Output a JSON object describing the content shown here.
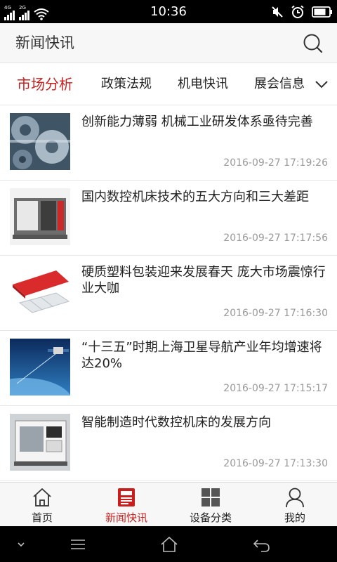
{
  "status_bar": {
    "time": "10:36",
    "sim1_label": "4G",
    "sim2_label": "2G",
    "icons": [
      "signal-4g-icon",
      "signal-2g-icon",
      "wifi-icon",
      "mute-icon",
      "alarm-icon",
      "battery-icon"
    ]
  },
  "header": {
    "title": "新闻快讯",
    "search_icon": "search-icon"
  },
  "tabs": {
    "items": [
      {
        "label": "市场分析",
        "active": true
      },
      {
        "label": "政策法规",
        "active": false
      },
      {
        "label": "机电快讯",
        "active": false
      },
      {
        "label": "展会信息",
        "active": false
      }
    ],
    "more_icon": "chevron-down-icon"
  },
  "news": [
    {
      "title": "创新能力薄弱 机械工业研发体系亟待完善",
      "time": "2016-09-27 17:19:26",
      "thumb": "gears-image"
    },
    {
      "title": "国内数控机床技术的五大方向和三大差距",
      "time": "2016-09-27 17:17:56",
      "thumb": "cnc-machine-image"
    },
    {
      "title": "硬质塑料包装迎来发展春天 庞大市场震惊行业大咖",
      "time": "2016-09-27 17:16:30",
      "thumb": "plastic-package-image"
    },
    {
      "title": "“十三五”时期上海卫星导航产业年均增速将达20%",
      "time": "2016-09-27 17:15:17",
      "thumb": "satellite-image"
    },
    {
      "title": "智能制造时代数控机床的发展方向",
      "time": "2016-09-27 17:13:30",
      "thumb": "cnc-lathe-image"
    }
  ],
  "bottom_nav": [
    {
      "label": "首页",
      "icon": "home-icon",
      "active": false
    },
    {
      "label": "新闻快讯",
      "icon": "news-icon",
      "active": true
    },
    {
      "label": "设备分类",
      "icon": "grid-icon",
      "active": false
    },
    {
      "label": "我的",
      "icon": "user-icon",
      "active": false
    }
  ],
  "system_nav": [
    "chevron-down-icon",
    "menu-icon",
    "home-icon",
    "back-icon"
  ],
  "colors": {
    "accent": "#c81e1e",
    "header_bg": "#f7f7f7",
    "timestamp": "#999999"
  }
}
